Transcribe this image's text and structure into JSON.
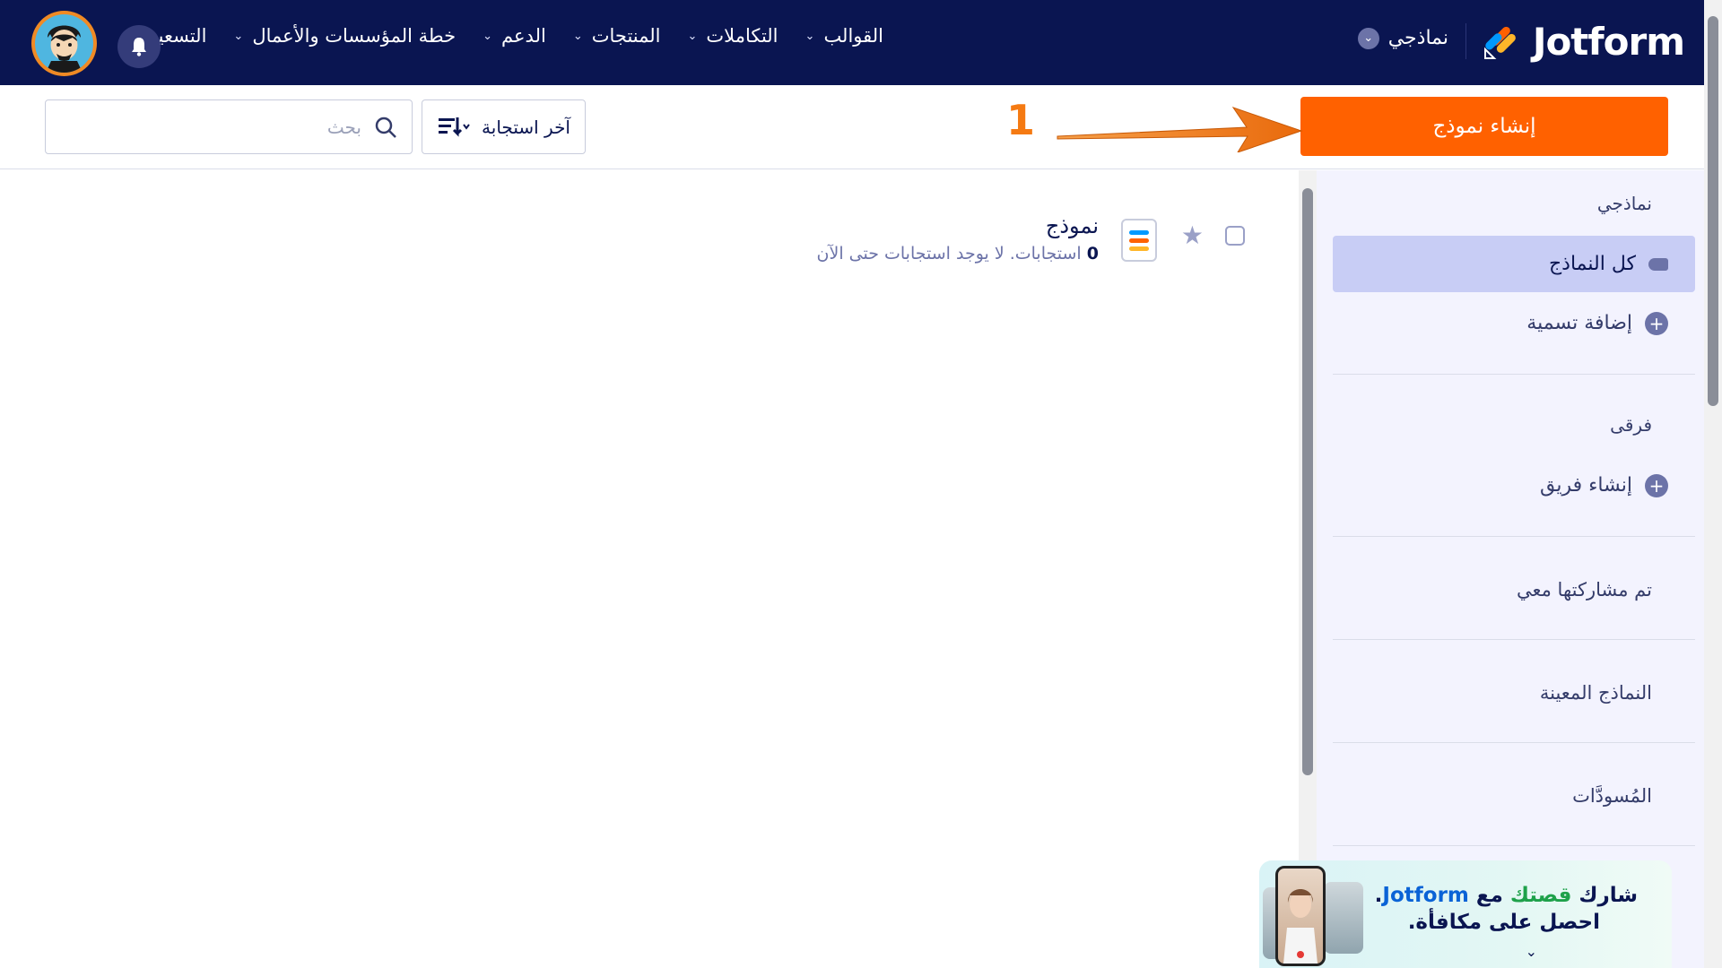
{
  "brand": {
    "name": "Jotform",
    "colors": {
      "nav_bg": "#0a1551",
      "primary": "#ff6100",
      "accent_orange": "#ff6100",
      "accent_blue": "#0099ff",
      "accent_yellow": "#ffb629"
    }
  },
  "nav": {
    "my_forms_label": "نماذجي",
    "items": [
      {
        "label": "القوالب"
      },
      {
        "label": "التكاملات"
      },
      {
        "label": "المنتجات"
      },
      {
        "label": "الدعم"
      },
      {
        "label": "خطة المؤسسات والأعمال"
      },
      {
        "label": "التسعير"
      }
    ],
    "icons": {
      "bell": "bell-icon",
      "avatar": "avatar"
    }
  },
  "toolbar": {
    "create_label": "إنشاء نموذج",
    "annotation_number": "1",
    "sort_label": "آخر استجابة",
    "search_placeholder": "بحث"
  },
  "sidebar": {
    "my_forms_heading": "نماذجي",
    "all_forms": "كل النماذج",
    "add_label": "إضافة تسمية",
    "teams_heading": "فرقى",
    "create_team": "إنشاء فريق",
    "shared_with_me": "تم مشاركتها معي",
    "assigned_forms": "النماذج المعينة",
    "drafts": "المُسودَّات"
  },
  "forms": [
    {
      "title": "نموذج",
      "response_count": "0",
      "status_text": "استجابات. لا يوجد استجابات حتى الآن"
    }
  ],
  "promo": {
    "line1_prefix": "شارك ",
    "line1_green": "قصتك",
    "line1_mid": " مع ",
    "line1_brand": "Jotform",
    "line1_end": ".",
    "line2": "احصل على مكافأة."
  }
}
